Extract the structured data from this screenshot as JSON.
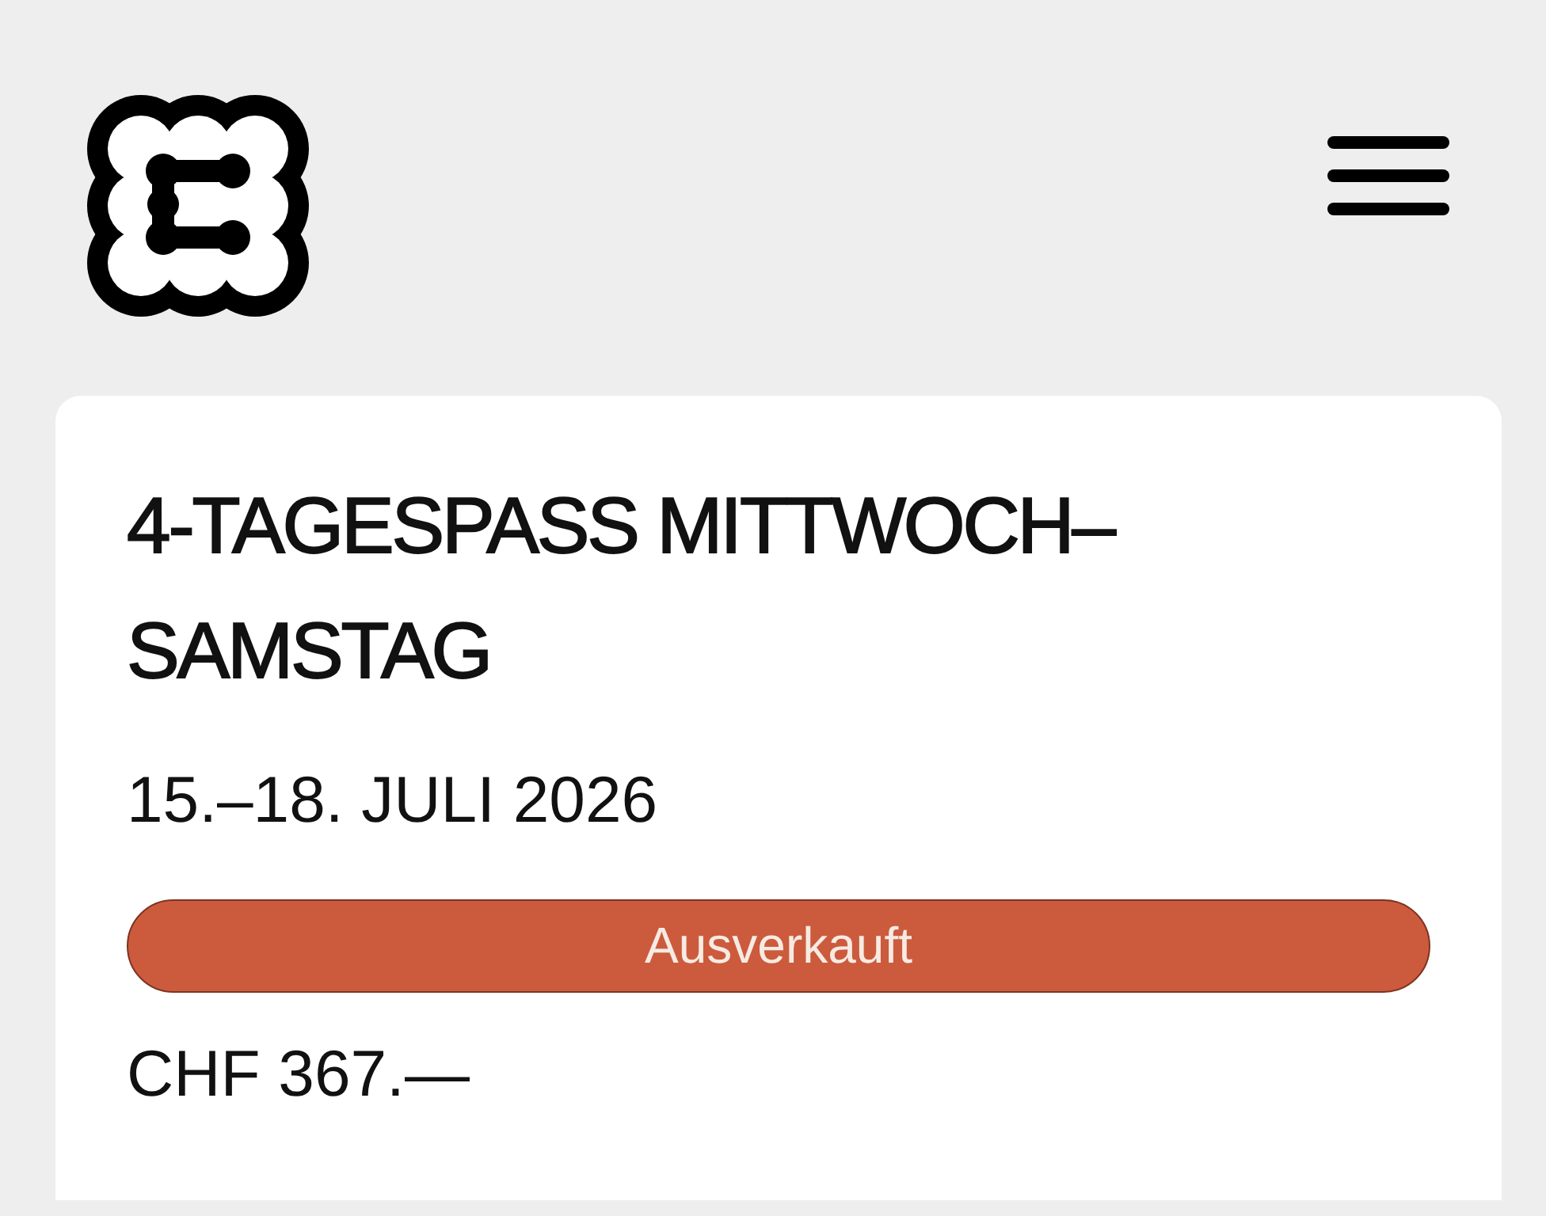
{
  "ticket": {
    "title": "4-TAGESPASS MITTWOCH–SAMSTAG",
    "dates": "15.–18. JULI 2026",
    "availability": {
      "kind": "sold_out",
      "label": "Ausverkauft"
    },
    "price": "CHF 367.—"
  }
}
